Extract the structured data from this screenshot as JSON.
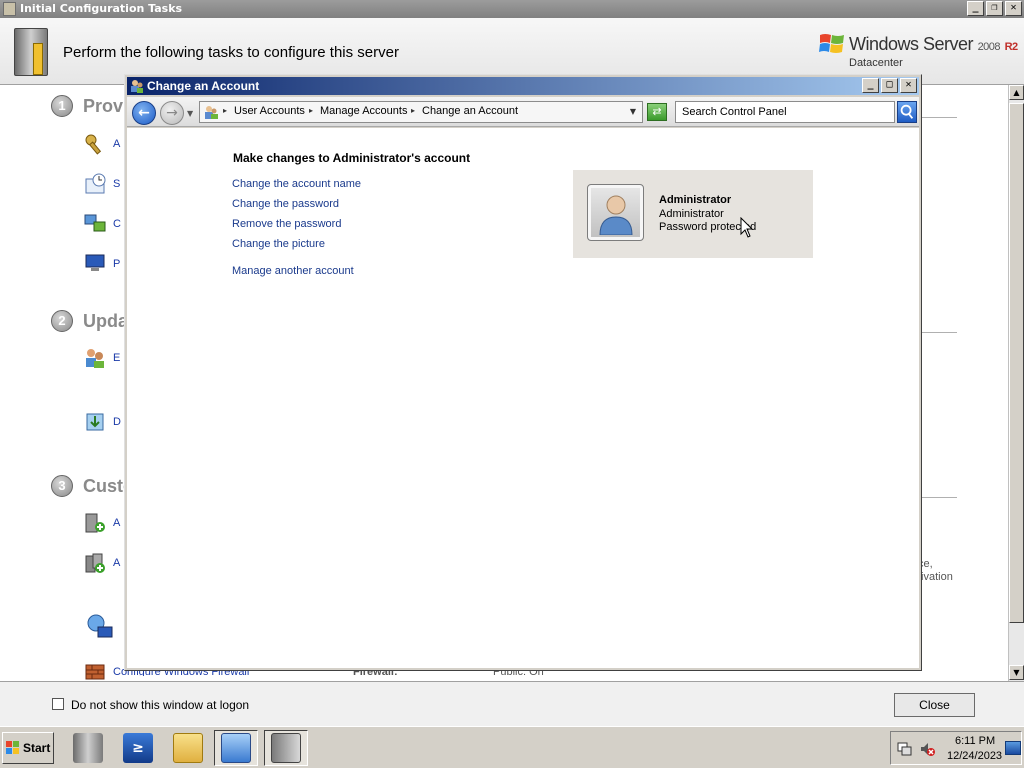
{
  "background_window": {
    "title": "Initial Configuration Tasks",
    "header_text": "Perform the following tasks to configure this server",
    "brand": {
      "name": "Windows Server",
      "version": "2008",
      "release": "R2",
      "edition": "Datacenter"
    },
    "sections": [
      {
        "number": "1",
        "title": "Provi"
      },
      {
        "number": "2",
        "title": "Upda"
      },
      {
        "number": "3",
        "title": "Custo"
      }
    ],
    "task_fragments": [
      "A",
      "S",
      "C",
      "P",
      "E",
      "D",
      "A",
      "A"
    ],
    "partial_task": "Configure Windows Firewall",
    "partial_label": "Firewall:",
    "partial_value": "Public: On",
    "right_text_1": "ce,",
    "right_text_2": "tivation",
    "checkbox_label": "Do not show this window at logon",
    "close_label": "Close"
  },
  "cp_window": {
    "title": "Change an Account",
    "breadcrumb": [
      "User Accounts",
      "Manage Accounts",
      "Change an Account"
    ],
    "search_placeholder": "Search Control Panel",
    "heading": "Make changes to Administrator's account",
    "links": [
      "Change the account name",
      "Change the password",
      "Remove the password",
      "Change the picture",
      "Manage another account"
    ],
    "account": {
      "name": "Administrator",
      "type": "Administrator",
      "status": "Password protected"
    }
  },
  "taskbar": {
    "start_label": "Start",
    "apps": [
      "server-manager-icon",
      "powershell-icon",
      "explorer-icon",
      "control-panel-icon",
      "initial-config-icon"
    ],
    "time": "6:11 PM",
    "date": "12/24/2023"
  },
  "colors": {
    "title_active_start": "#0a246a",
    "title_active_end": "#a6caf0",
    "link": "#1a3a8c"
  }
}
